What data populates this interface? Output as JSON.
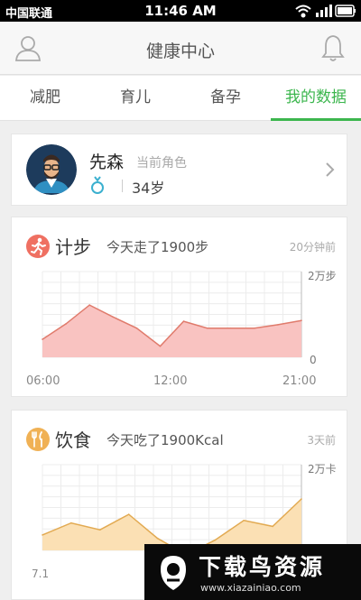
{
  "status_bar": {
    "carrier": "中国联通",
    "time": "11:46 AM"
  },
  "header": {
    "title": "健康中心",
    "left_icon": "user-icon",
    "right_icon": "bell-icon"
  },
  "tabs": [
    {
      "label": "减肥",
      "active": false
    },
    {
      "label": "育儿",
      "active": false
    },
    {
      "label": "备孕",
      "active": false
    },
    {
      "label": "我的数据",
      "active": true
    }
  ],
  "accent_color": "#3cb64e",
  "profile": {
    "name": "先森",
    "role": "当前角色",
    "gender_icon": "male-symbol-icon",
    "age": "34岁"
  },
  "steps_card": {
    "icon": "running-icon",
    "icon_color": "#ef7062",
    "title": "计步",
    "summary": "今天走了1900步",
    "time": "20分钟前",
    "chart_data": {
      "type": "area",
      "x_ticks": [
        "06:00",
        "12:00",
        "21:00"
      ],
      "y_ticks": [
        "2万步",
        "0"
      ],
      "values": [
        0.21,
        0.39,
        0.61,
        0.47,
        0.34,
        0.13,
        0.42,
        0.34,
        0.34,
        0.34,
        0.38,
        0.43
      ],
      "ylim": [
        0,
        1
      ],
      "fill_color": "#f9c3c1",
      "line_color": "#e07b6c"
    }
  },
  "diet_card": {
    "icon": "fork-knife-icon",
    "icon_color": "#f0b155",
    "title": "饮食",
    "summary": "今天吃了1900Kcal",
    "time": "3天前",
    "chart_data": {
      "type": "area",
      "x_ticks": [
        "7.1"
      ],
      "y_ticks": [
        "2万卡"
      ],
      "values": [
        0.18,
        0.32,
        0.24,
        0.42,
        0.14,
        -0.05,
        0.12,
        0.35,
        0.28,
        0.6
      ],
      "ylim": [
        0,
        1
      ],
      "fill_color": "#fbe0b4",
      "line_color": "#e2aa52"
    }
  },
  "watermark": {
    "title": "下载鸟资源",
    "url": "www.xiazainiao.com"
  }
}
